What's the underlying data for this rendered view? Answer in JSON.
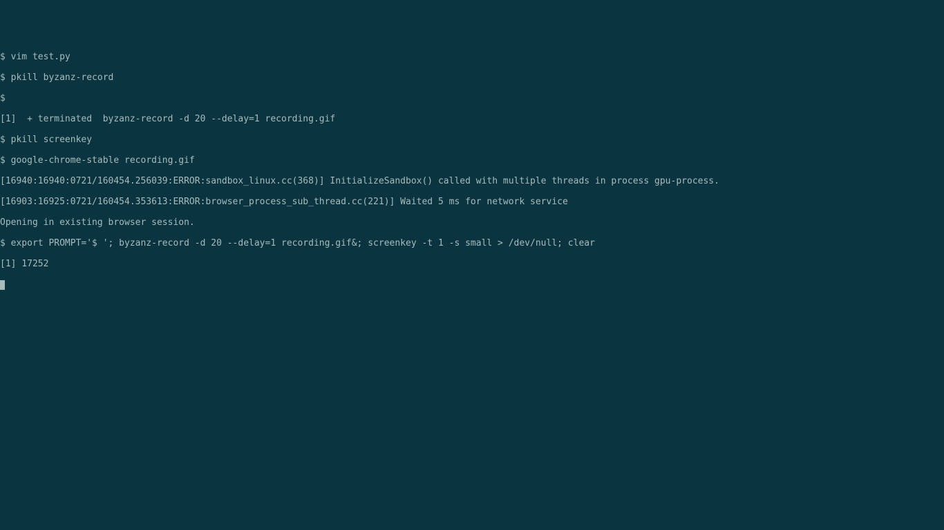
{
  "terminal": {
    "lines": [
      "$ vim test.py",
      "$ pkill byzanz-record",
      "$",
      "[1]  + terminated  byzanz-record -d 20 --delay=1 recording.gif",
      "$ pkill screenkey",
      "$ google-chrome-stable recording.gif",
      "[16940:16940:0721/160454.256039:ERROR:sandbox_linux.cc(368)] InitializeSandbox() called with multiple threads in process gpu-process.",
      "[16903:16925:0721/160454.353613:ERROR:browser_process_sub_thread.cc(221)] Waited 5 ms for network service",
      "Opening in existing browser session.",
      "$ export PROMPT='$ '; byzanz-record -d 20 --delay=1 recording.gif&; screenkey -t 1 -s small > /dev/null; clear",
      "[1] 17252"
    ]
  }
}
